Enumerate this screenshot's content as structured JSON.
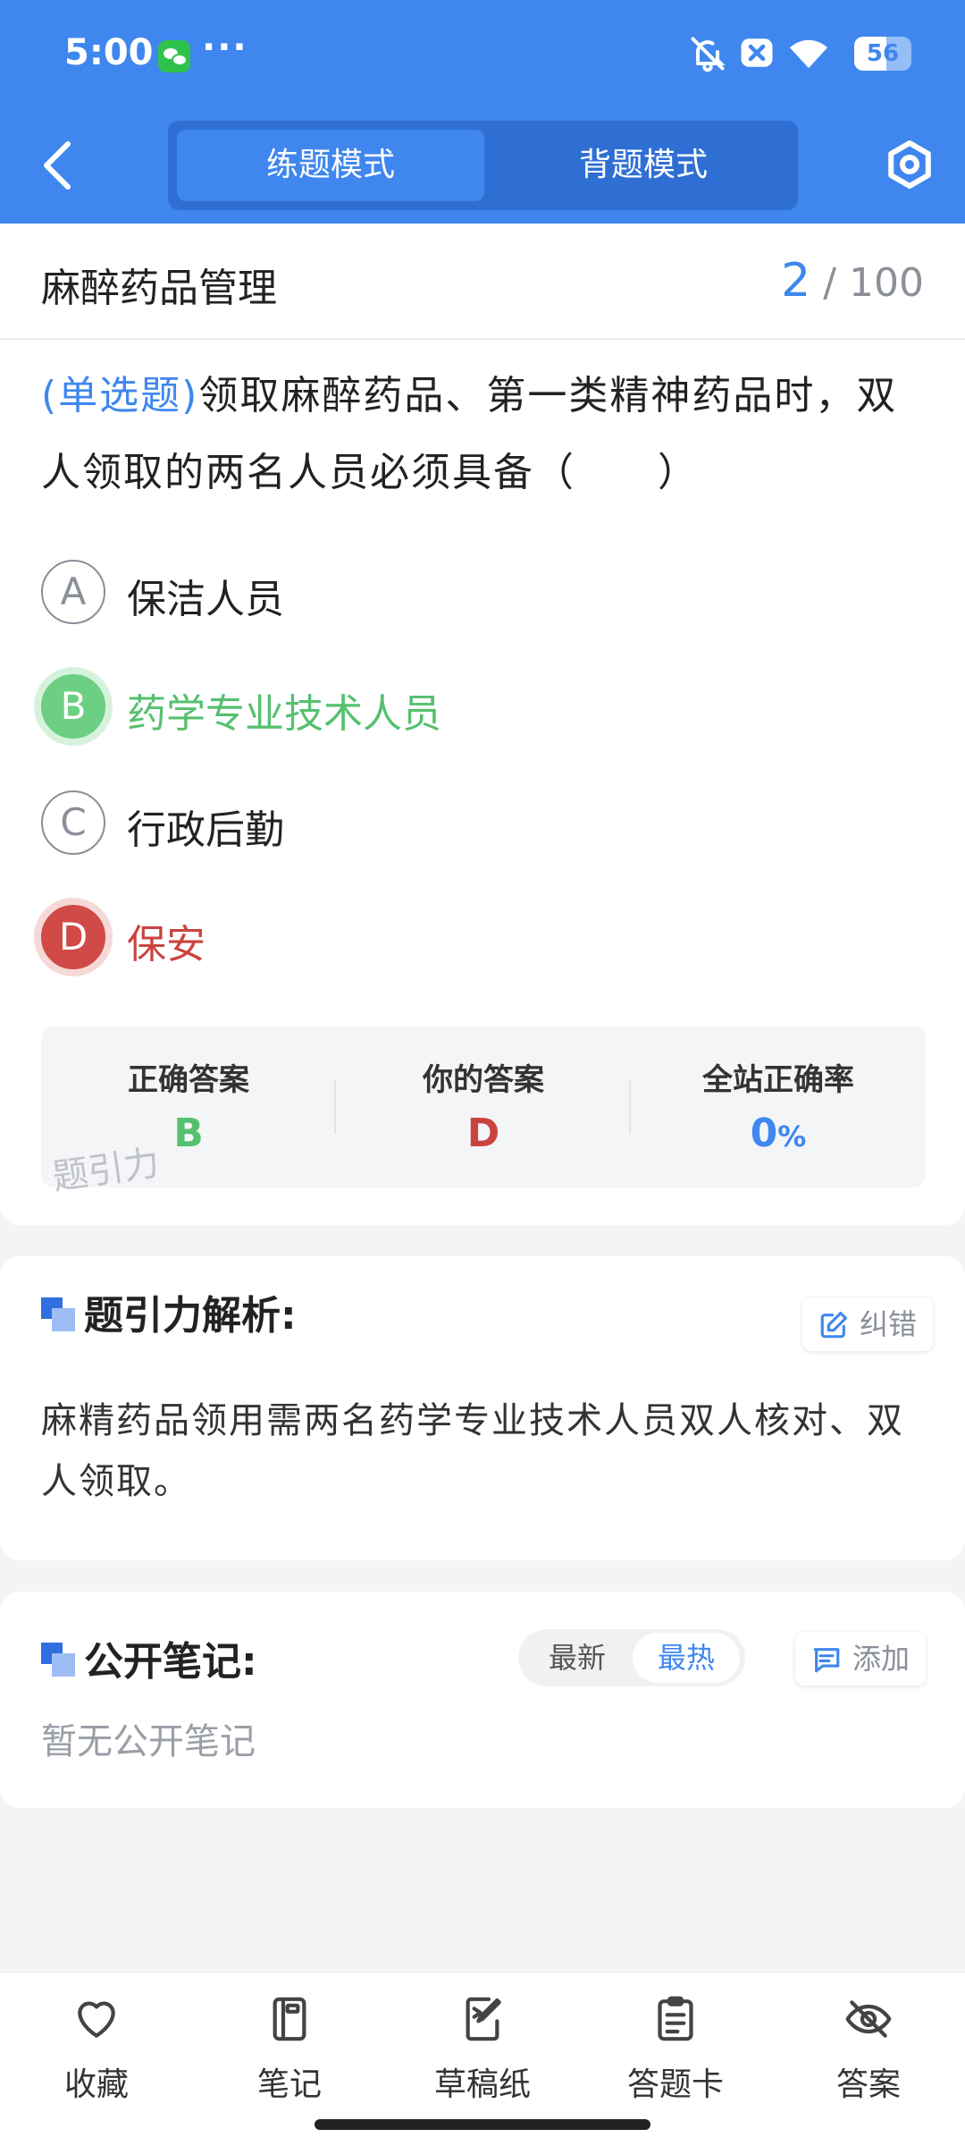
{
  "status_bar": {
    "time": "5:00",
    "more": "···",
    "battery": "56",
    "battery_level": 0.56,
    "icons": [
      "wechat-icon",
      "bell-off-icon",
      "close-badge-icon",
      "wifi-icon",
      "battery-icon"
    ]
  },
  "header": {
    "mode_practice": "练题模式",
    "mode_memorize": "背题模式",
    "active_mode": "练题模式",
    "accent_color": "#3f87ee"
  },
  "question": {
    "chapter": "麻醉药品管理",
    "current": "2",
    "separator": "/",
    "total": "100",
    "type_label": "(单选题)",
    "text": "领取麻醉药品、第一类精神药品时，双人领取的两名人员必须具备（　　）"
  },
  "options": [
    {
      "letter": "A",
      "text": "保洁人员",
      "state": "normal"
    },
    {
      "letter": "B",
      "text": "药学专业技术人员",
      "state": "correct"
    },
    {
      "letter": "C",
      "text": "行政后勤",
      "state": "normal"
    },
    {
      "letter": "D",
      "text": "保安",
      "state": "wrong"
    }
  ],
  "answer_summary": {
    "correct_label": "正确答案",
    "correct_value": "B",
    "yours_label": "你的答案",
    "yours_value": "D",
    "rate_label": "全站正确率",
    "rate_value": "0",
    "rate_unit": "%",
    "watermark": "题引力",
    "colors": {
      "correct": "#56c06f",
      "wrong": "#c9443f",
      "rate": "#3f87ee"
    }
  },
  "analysis": {
    "title": "题引力解析:",
    "report_label": "纠错",
    "text": "麻精药品领用需两名药学专业技术人员双人核对、双人领取。"
  },
  "notes": {
    "title": "公开笔记:",
    "sort_latest": "最新",
    "sort_hot": "最热",
    "active_sort": "最热",
    "add_label": "添加",
    "empty_text": "暂无公开笔记"
  },
  "bottom_nav": [
    {
      "label": "收藏",
      "icon": "heart-icon"
    },
    {
      "label": "笔记",
      "icon": "notebook-icon"
    },
    {
      "label": "草稿纸",
      "icon": "draft-paper-icon"
    },
    {
      "label": "答题卡",
      "icon": "answer-sheet-icon"
    },
    {
      "label": "答案",
      "icon": "eye-off-icon"
    }
  ]
}
